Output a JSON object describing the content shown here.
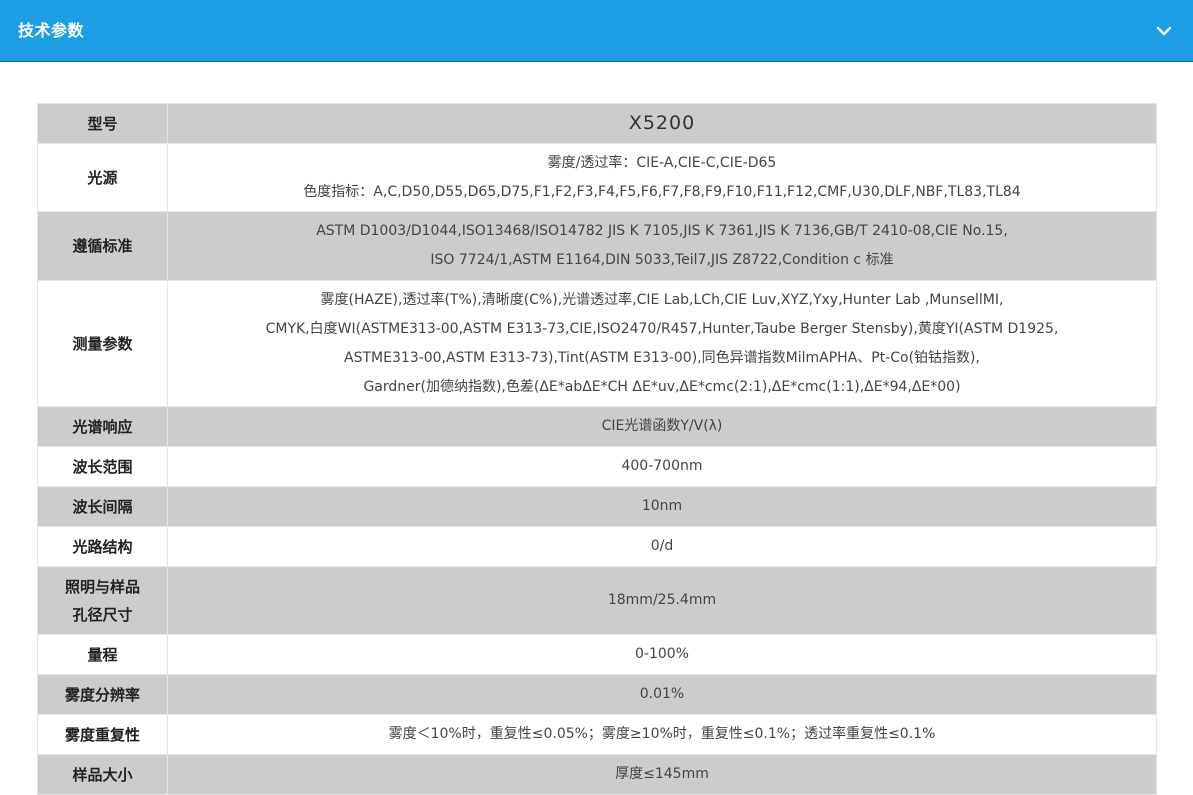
{
  "header": {
    "title": "技术参数",
    "toggle_icon": "chevron-down-icon",
    "background_color": "#1b9ee3"
  },
  "table": {
    "rows": [
      {
        "label": "型号",
        "lines": [
          "X5200"
        ]
      },
      {
        "label": "光源",
        "lines": [
          "雾度/透过率：CIE-A,CIE-C,CIE-D65",
          "色度指标：A,C,D50,D55,D65,D75,F1,F2,F3,F4,F5,F6,F7,F8,F9,F10,F11,F12,CMF,U30,DLF,NBF,TL83,TL84"
        ]
      },
      {
        "label": "遵循标准",
        "lines": [
          "ASTM D1003/D1044,ISO13468/ISO14782 JIS K 7105,JIS K 7361,JIS K 7136,GB/T 2410-08,CIE No.15,",
          "ISO 7724/1,ASTM E1164,DIN 5033,Teil7,JIS Z8722,Condition c 标准"
        ]
      },
      {
        "label": "测量参数",
        "lines": [
          "雾度(HAZE),透过率(T%),清晰度(C%),光谱透过率,CIE Lab,LCh,CIE Luv,XYZ,Yxy,Hunter Lab ,MunsellMI,",
          "CMYK,白度WI(ASTME313-00,ASTM E313-73,CIE,ISO2470/R457,Hunter,Taube Berger Stensby),黄度YI(ASTM D1925,",
          "ASTME313-00,ASTM E313-73),Tint(ASTM E313-00),同色异谱指数MilmAPHA、Pt-Co(铂钴指数),",
          "Gardner(加德纳指数),色差(ΔE*abΔE*CH ΔE*uv,ΔE*cmc(2:1),ΔE*cmc(1:1),ΔE*94,ΔE*00)"
        ]
      },
      {
        "label": "光谱响应",
        "lines": [
          "CIE光谱函数Y/V(λ)"
        ]
      },
      {
        "label": "波长范围",
        "lines": [
          "400-700nm"
        ]
      },
      {
        "label": "波长间隔",
        "lines": [
          "10nm"
        ]
      },
      {
        "label": "光路结构",
        "lines": [
          "0/d"
        ]
      },
      {
        "label": "照明与样品孔径尺寸",
        "label_lines": [
          "照明与样品",
          "孔径尺寸"
        ],
        "lines": [
          "18mm/25.4mm"
        ]
      },
      {
        "label": "量程",
        "lines": [
          "0-100%"
        ]
      },
      {
        "label": "雾度分辨率",
        "lines": [
          "0.01%"
        ]
      },
      {
        "label": "雾度重复性",
        "lines": [
          "雾度＜10%时，重复性≤0.05%；雾度≥10%时，重复性≤0.1%；透过率重复性≤0.1%"
        ]
      },
      {
        "label": "样品大小",
        "lines": [
          "厚度≤145mm"
        ]
      }
    ]
  }
}
